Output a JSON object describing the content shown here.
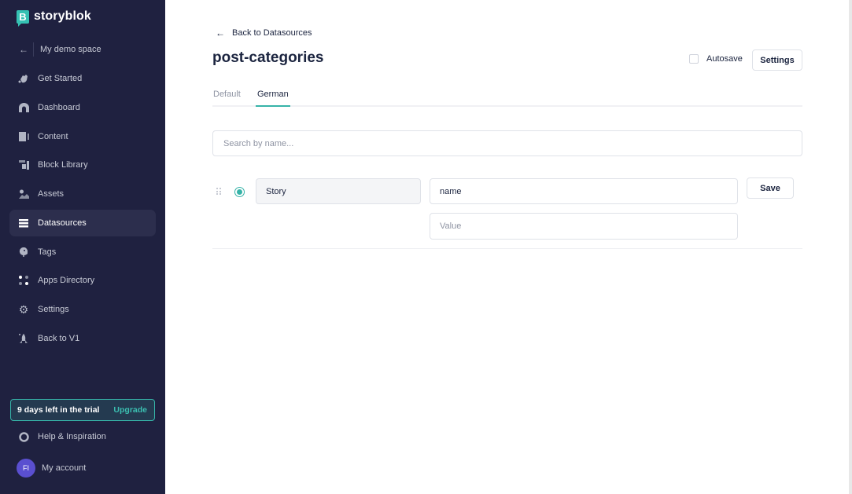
{
  "sidebar": {
    "brand": "storyblok",
    "brand_mark": "B",
    "space": {
      "label": "My demo space",
      "icon": "arrow-left-icon"
    },
    "items": [
      {
        "label": "Get Started",
        "icon": "waving-hand-icon",
        "active": false
      },
      {
        "label": "Dashboard",
        "icon": "dashboard-icon",
        "active": false
      },
      {
        "label": "Content",
        "icon": "content-icon",
        "active": false
      },
      {
        "label": "Block Library",
        "icon": "block-library-icon",
        "active": false
      },
      {
        "label": "Assets",
        "icon": "assets-icon",
        "active": false
      },
      {
        "label": "Datasources",
        "icon": "datasources-icon",
        "active": true
      },
      {
        "label": "Tags",
        "icon": "tag-icon",
        "active": false
      },
      {
        "label": "Apps Directory",
        "icon": "apps-icon",
        "active": false
      },
      {
        "label": "Settings",
        "icon": "gear-icon",
        "active": false
      },
      {
        "label": "Back to V1",
        "icon": "rocket-icon",
        "active": false
      }
    ],
    "trial": {
      "text": "9 days left in the trial",
      "upgrade_label": "Upgrade"
    },
    "help": {
      "label": "Help & Inspiration",
      "icon": "lifebuoy-icon"
    },
    "account": {
      "label": "My account",
      "initials": "FI"
    }
  },
  "main": {
    "back_label": "Back to Datasources",
    "title": "post-categories",
    "autosave_label": "Autosave",
    "autosave_checked": false,
    "settings_label": "Settings",
    "tabs": [
      {
        "label": "Default",
        "active": false
      },
      {
        "label": "German",
        "active": true
      }
    ],
    "search_placeholder": "Search by name...",
    "entry": {
      "name": "Story",
      "key": "name",
      "value_placeholder": "Value",
      "value": "",
      "save_label": "Save",
      "selected": true
    }
  },
  "colors": {
    "sidebar_bg": "#1f2140",
    "accent": "#36b3a8",
    "avatar": "#5a4fd0",
    "text": "#1b243f"
  }
}
